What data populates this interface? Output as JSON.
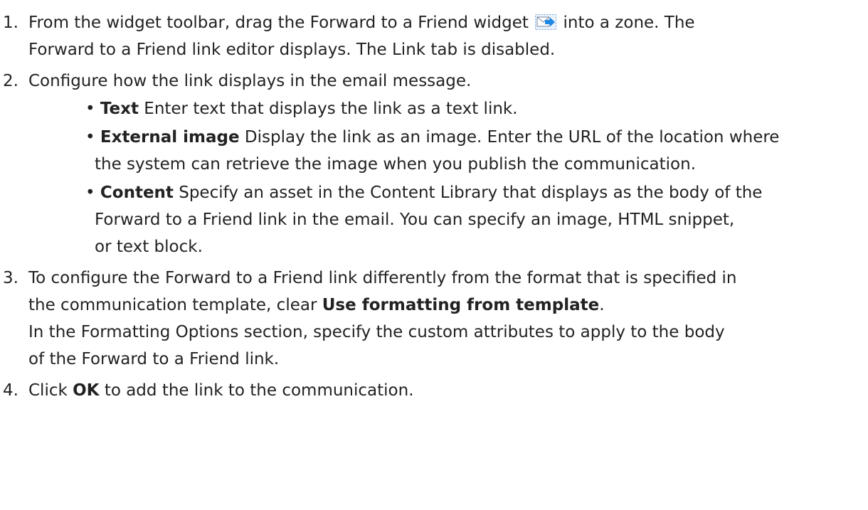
{
  "steps": [
    {
      "num": "1.",
      "lines": {
        "l1_before": "From the widget toolbar, drag the Forward to a Friend widget",
        "l1_after": "into a zone. The",
        "l2": "Forward to a Friend link editor displays. The Link tab is disabled."
      }
    },
    {
      "num": "2.",
      "lines": {
        "l1": "Configure how the link displays in the email message."
      },
      "bullets": [
        {
          "term": "Text",
          "l1": "Enter text that displays the link as a text link."
        },
        {
          "term": "External image",
          "l1": "Display the link as an image. Enter the URL of the location where",
          "l2": "the system can retrieve the image when you publish the communication."
        },
        {
          "term": "Content",
          "l1": "Specify an asset in the Content Library that displays as the body of the",
          "l2": "Forward to a Friend link in the email. You can specify an image, HTML snippet,",
          "l3": "or text block."
        }
      ]
    },
    {
      "num": "3.",
      "lines": {
        "l1": "To configure the Forward to a Friend link differently from the format that is specified in",
        "l2_before": "the communication template, clear",
        "l2_bold": "Use formatting from template",
        "l2_after": ".",
        "l3": "In the Formatting Options section, specify the custom attributes to apply to the body",
        "l4": "of the Forward to a Friend link."
      }
    },
    {
      "num": "4.",
      "lines": {
        "l1_before": "Click",
        "l1_bold": "OK",
        "l1_after": "to add the link to the communication."
      }
    }
  ],
  "bullet_char": "•",
  "icons": {
    "widget_icon": "forward-to-friend-icon"
  },
  "colors": {
    "text": "#222222",
    "icon_blue": "#1e88e5",
    "icon_border": "#6aa0d8"
  }
}
